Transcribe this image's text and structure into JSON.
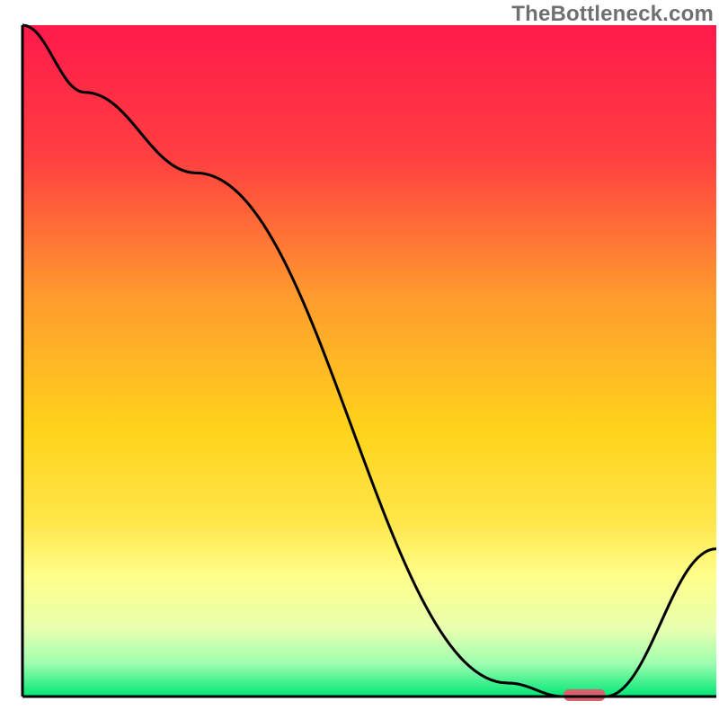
{
  "watermark": "TheBottleneck.com",
  "chart_data": {
    "type": "line",
    "title": "",
    "xlabel": "",
    "ylabel": "",
    "xlim": [
      0,
      100
    ],
    "ylim": [
      0,
      100
    ],
    "gradient_stops": [
      {
        "offset": 0,
        "color": "#ff1a4b"
      },
      {
        "offset": 20,
        "color": "#ff4040"
      },
      {
        "offset": 40,
        "color": "#ff9a2e"
      },
      {
        "offset": 60,
        "color": "#ffd31a"
      },
      {
        "offset": 74,
        "color": "#ffe64a"
      },
      {
        "offset": 82,
        "color": "#ffff8a"
      },
      {
        "offset": 90,
        "color": "#e8ffb0"
      },
      {
        "offset": 95,
        "color": "#a0ffb0"
      },
      {
        "offset": 100,
        "color": "#00e676"
      }
    ],
    "series": [
      {
        "name": "bottleneck-curve",
        "x": [
          0,
          9,
          25,
          70,
          78,
          84,
          100
        ],
        "values": [
          100,
          90,
          78,
          2,
          0,
          0,
          22
        ]
      }
    ],
    "marker": {
      "name": "highlight-bar",
      "x_start": 78,
      "x_end": 84,
      "color": "#d9606d"
    },
    "axes": {
      "line_color": "#000000",
      "line_width": 3
    }
  }
}
